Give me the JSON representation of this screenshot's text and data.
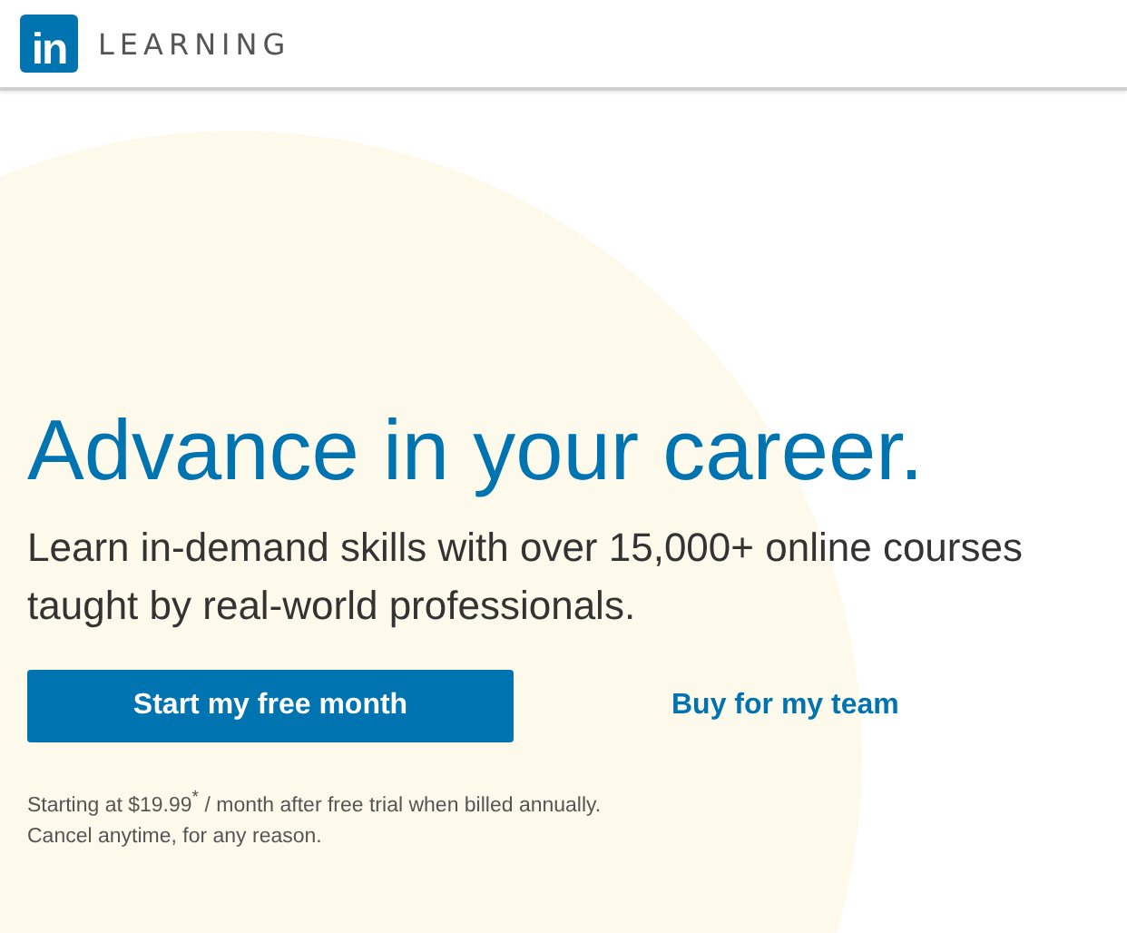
{
  "header": {
    "logo": "in",
    "product": "LEARNING"
  },
  "hero": {
    "headline": "Advance in your career.",
    "subheading_lines": [
      "Learn in-demand skills with over 15,000+ online courses",
      "taught by real-world professionals."
    ],
    "primary_button": "Start my free month",
    "secondary_link": "Buy for my team",
    "disclaimer_lines": [
      "Starting at $19.99$^{*}$ / month after free trial when billed annually.",
      "Cancel anytime, for any reason."
    ]
  }
}
